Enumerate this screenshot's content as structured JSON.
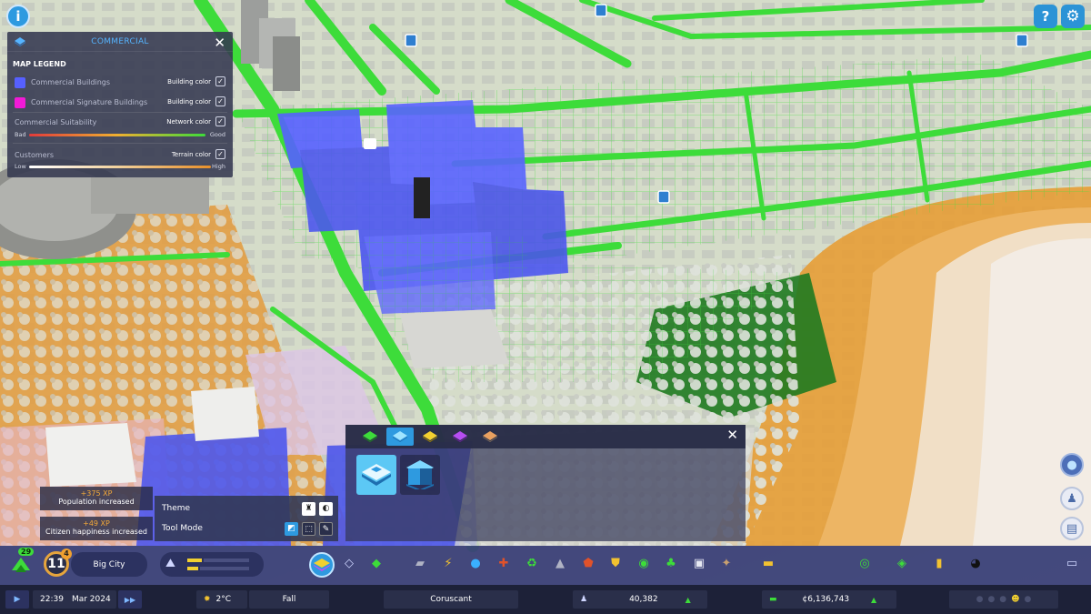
{
  "top_buttons": {
    "info_label": "i",
    "help_label": "?",
    "settings_label": "⚙"
  },
  "legend": {
    "title": "COMMERCIAL",
    "close_label": "✕",
    "subtitle": "MAP LEGEND",
    "rows": [
      {
        "name": "Commercial Buildings",
        "option": "Building color",
        "checked": true,
        "color": "#5660ff"
      },
      {
        "name": "Commercial Signature Buildings",
        "option": "Building color",
        "checked": true,
        "color": "#f21ad6"
      }
    ],
    "suitability": {
      "name": "Commercial Suitability",
      "option": "Network color",
      "low": "Bad",
      "high": "Good"
    },
    "customers": {
      "name": "Customers",
      "option": "Terrain color",
      "low": "Low",
      "high": "High"
    },
    "check_mark": "✓"
  },
  "notifications": [
    {
      "xp": "+375 XP",
      "message": "Population increased"
    },
    {
      "xp": "+49 XP",
      "message": "Citizen happiness increased"
    }
  ],
  "tool_panel": {
    "theme_label": "Theme",
    "tool_mode_label": "Tool Mode"
  },
  "zone_panel": {
    "close_label": "✕"
  },
  "city": {
    "name": "Big City",
    "level": "11",
    "level_badge": "4",
    "development_points": "29"
  },
  "status": {
    "time": "22:39",
    "date": "Mar 2024",
    "temperature": "2°C",
    "season": "Fall",
    "city_title": "Coruscant",
    "population": "40,382",
    "money": "¢6,136,743"
  },
  "colors": {
    "commercial_zone": "#5660ff",
    "road_green": "#3ddc3a",
    "suit_bad": "#e23b3b",
    "suit_good": "#3ddc3a",
    "accent": "#2e9ae0"
  }
}
